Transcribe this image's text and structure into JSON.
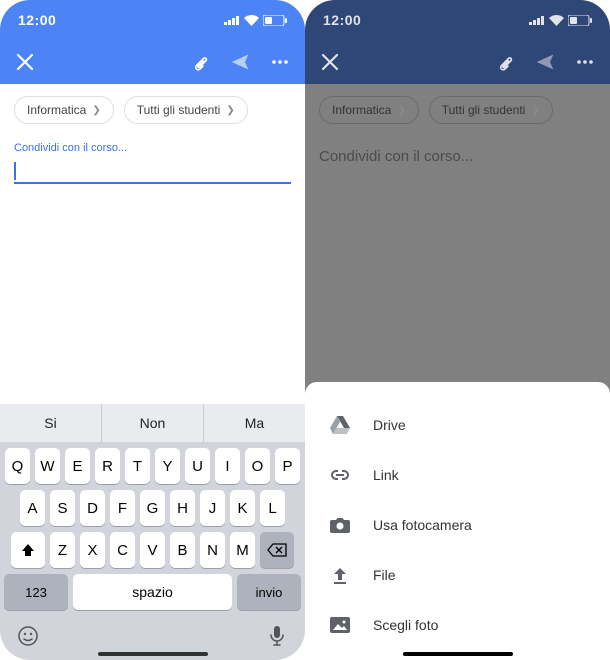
{
  "statusbar": {
    "time": "12:00"
  },
  "appbar": {
    "close": "×",
    "attach": "attach",
    "send": "send",
    "more": "more"
  },
  "chips": {
    "course": "Informatica",
    "audience": "Tutti gli studenti"
  },
  "compose": {
    "label": "Condividi con il corso...",
    "placeholder": "Condividi con il corso..."
  },
  "keyboard": {
    "suggestions": [
      "Si",
      "Non",
      "Ma"
    ],
    "row1": [
      "Q",
      "W",
      "E",
      "R",
      "T",
      "Y",
      "U",
      "I",
      "O",
      "P"
    ],
    "row2": [
      "A",
      "S",
      "D",
      "F",
      "G",
      "H",
      "J",
      "K",
      "L"
    ],
    "row3": [
      "Z",
      "X",
      "C",
      "V",
      "B",
      "N",
      "M"
    ],
    "num": "123",
    "space": "spazio",
    "enter": "invio"
  },
  "sheet": {
    "items": [
      {
        "icon": "drive",
        "label": "Drive"
      },
      {
        "icon": "link",
        "label": "Link"
      },
      {
        "icon": "camera",
        "label": "Usa fotocamera"
      },
      {
        "icon": "upload",
        "label": "File"
      },
      {
        "icon": "photo",
        "label": "Scegli foto"
      }
    ]
  }
}
